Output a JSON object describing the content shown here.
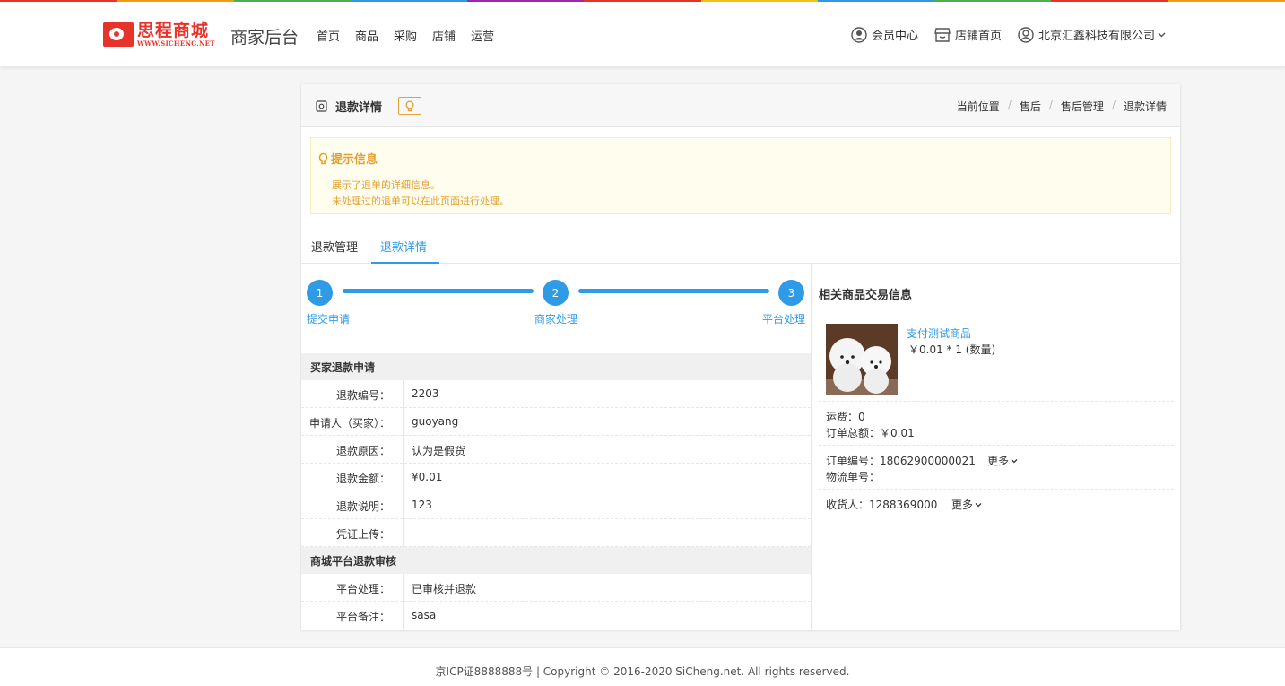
{
  "brand": {
    "logo_name": "思程商城",
    "logo_url": "WWW.SICHENG.NET",
    "app_title": "商家后台",
    "strip_colors": [
      "#e8332a",
      "#f39c12",
      "#4caf50",
      "#2f9be6",
      "#9c27b0",
      "#e8332a",
      "#f1c40f",
      "#2f9be6",
      "#4caf50",
      "#e8332a",
      "#f39c12"
    ]
  },
  "nav": {
    "items": [
      "首页",
      "商品",
      "采购",
      "店铺",
      "运营"
    ]
  },
  "header_right": {
    "member_center": "会员中心",
    "shop_home": "店铺首页",
    "company": "北京汇鑫科技有限公司"
  },
  "panel": {
    "title": "退款详情",
    "breadcrumb": [
      "当前位置",
      "售后",
      "售后管理",
      "退款详情"
    ]
  },
  "notice": {
    "title": "提示信息",
    "lines": [
      "展示了退单的详细信息。",
      "未处理过的退单可以在此页面进行处理。"
    ]
  },
  "tabs": [
    {
      "label": "退款管理",
      "active": false
    },
    {
      "label": "退款详情",
      "active": true
    }
  ],
  "steps": [
    {
      "num": "1",
      "label": "提交申请"
    },
    {
      "num": "2",
      "label": "商家处理"
    },
    {
      "num": "3",
      "label": "平台处理"
    }
  ],
  "buyer_section": {
    "title": "买家退款申请",
    "rows": [
      {
        "label": "退款编号：",
        "value": "2203"
      },
      {
        "label": "申请人（买家）：",
        "value": "guoyang"
      },
      {
        "label": "退款原因：",
        "value": "认为是假货"
      },
      {
        "label": "退款金额：",
        "value": "¥0.01"
      },
      {
        "label": "退款说明：",
        "value": "123"
      },
      {
        "label": "凭证上传：",
        "value": ""
      }
    ]
  },
  "platform_section": {
    "title": "商城平台退款审核",
    "rows": [
      {
        "label": "平台处理：",
        "value": "已审核并退款"
      },
      {
        "label": "平台备注：",
        "value": "sasa"
      }
    ]
  },
  "related": {
    "title": "相关商品交易信息",
    "product_name": "支付测试商品",
    "product_price": "￥0.01 * 1 (数量)",
    "shipping": "运费：0",
    "order_total": "订单总额：￥0.01",
    "order_no": "订单编号：18062900000021",
    "more_label": "更多",
    "logistics_no": "物流单号：",
    "receiver": "收货人：1288369000"
  },
  "footer": {
    "text": "京ICP证8888888号 | Copyright © 2016-2020 SiCheng.net. All rights reserved."
  }
}
